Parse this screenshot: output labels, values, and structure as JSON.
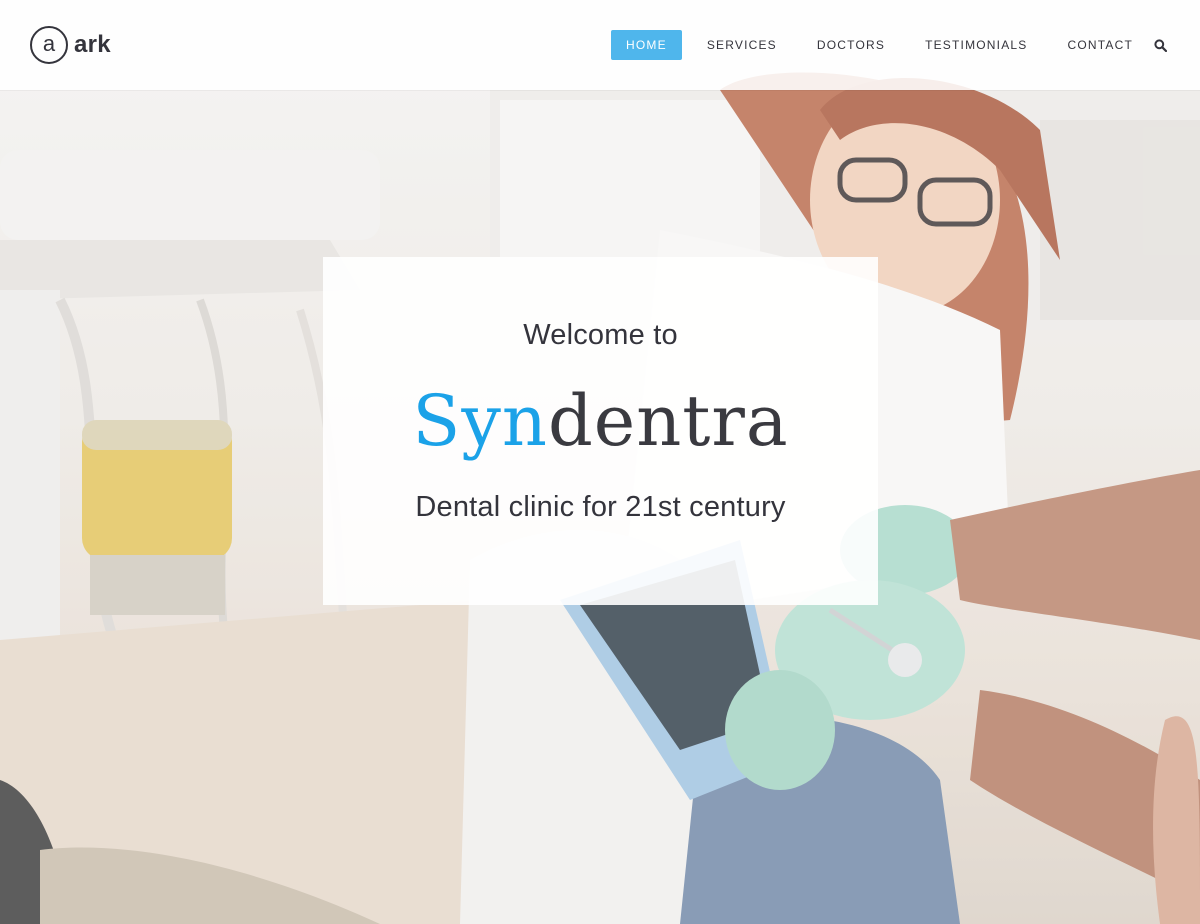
{
  "header": {
    "logo": {
      "mark": "a",
      "name": "ark"
    },
    "nav": [
      {
        "label": "HOME",
        "active": true
      },
      {
        "label": "SERVICES",
        "active": false
      },
      {
        "label": "DOCTORS",
        "active": false
      },
      {
        "label": "TESTIMONIALS",
        "active": false
      },
      {
        "label": "CONTACT",
        "active": false
      }
    ],
    "search_icon": "search-icon"
  },
  "hero": {
    "welcome": "Welcome to",
    "brand_accent": "Syn",
    "brand_rest": "dentra",
    "tagline": "Dental clinic for 21st century",
    "background": "dentist-office-photo"
  },
  "colors": {
    "accent": "#4fb6ec",
    "brand_accent": "#1ba2e8",
    "text": "#34343c"
  }
}
